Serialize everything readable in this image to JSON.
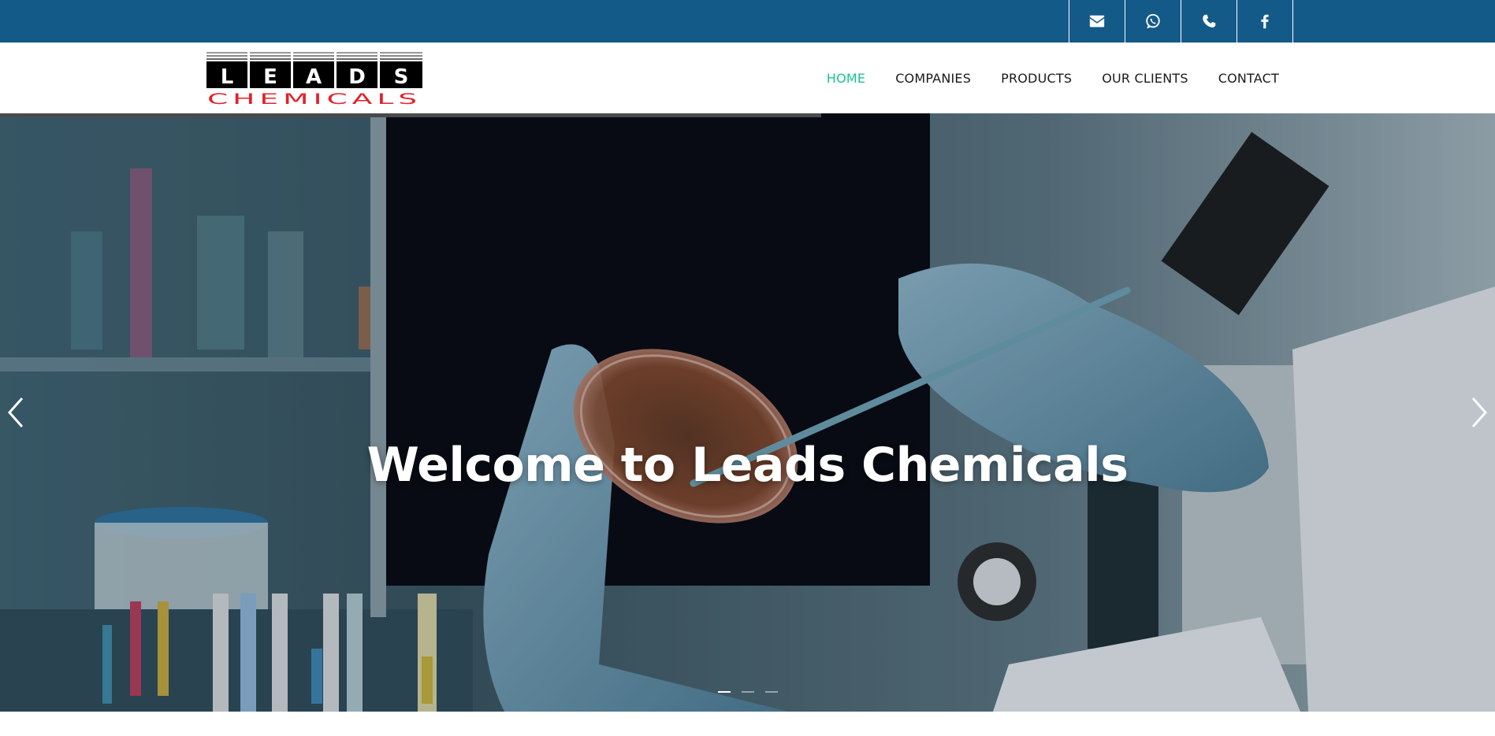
{
  "topbar": {
    "bg_color": "#145a89",
    "social": [
      {
        "icon": "envelope-icon"
      },
      {
        "icon": "whatsapp-icon"
      },
      {
        "icon": "phone-icon"
      },
      {
        "icon": "facebook-icon"
      }
    ]
  },
  "header": {
    "logo": {
      "top_text": "LEADS",
      "bottom_text": "CHEMICALS"
    },
    "nav": [
      {
        "label": "HOME",
        "active": true
      },
      {
        "label": "COMPANIES",
        "active": false
      },
      {
        "label": "PRODUCTS",
        "active": false
      },
      {
        "label": "OUR CLIENTS",
        "active": false
      },
      {
        "label": "CONTACT",
        "active": false
      }
    ],
    "active_color": "#19c394"
  },
  "hero": {
    "title": "Welcome to Leads Chemicals",
    "image": "lab-petri-dish-gloved-hands-photo",
    "slides_total": 3,
    "active_slide": 1
  }
}
